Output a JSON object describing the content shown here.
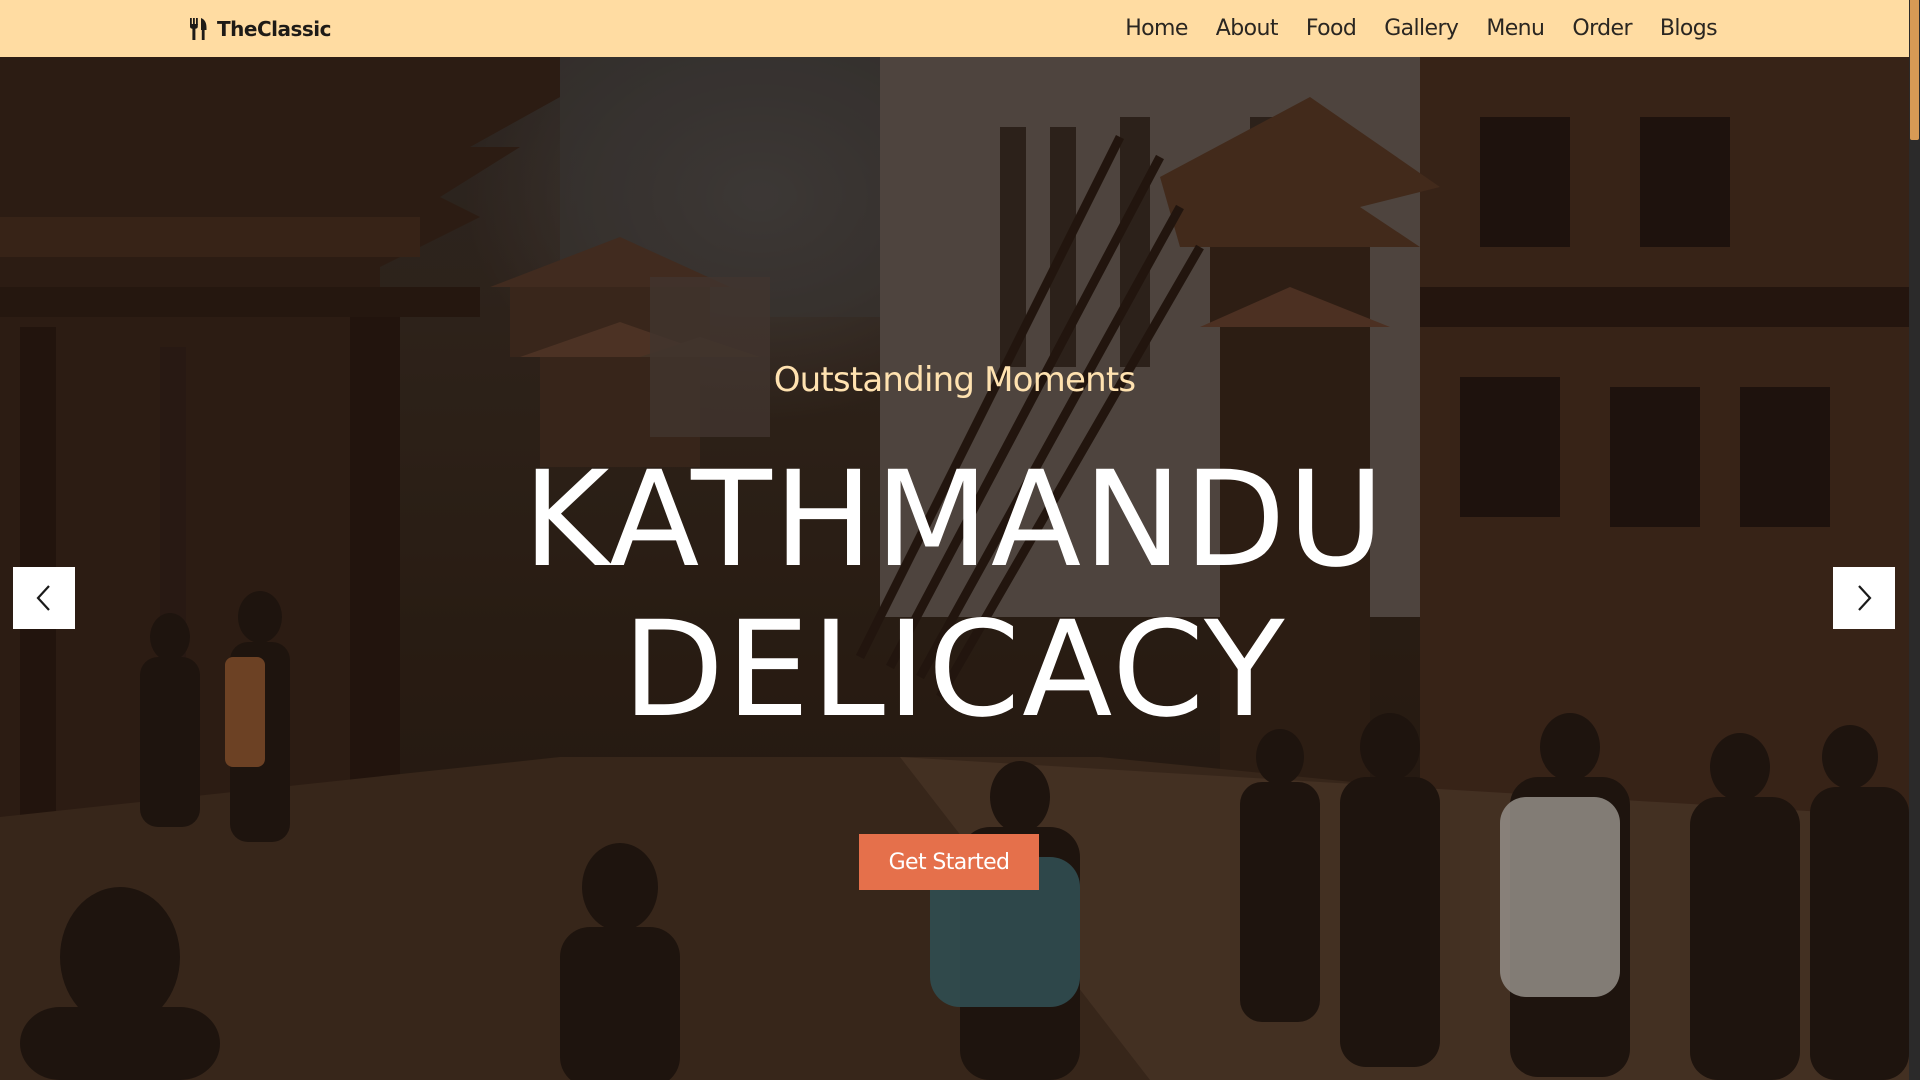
{
  "navbar": {
    "brand": {
      "icon": "fork-knife-icon",
      "name": "TheClassic"
    },
    "links": [
      {
        "label": "Home"
      },
      {
        "label": "About"
      },
      {
        "label": "Food"
      },
      {
        "label": "Gallery"
      },
      {
        "label": "Menu"
      },
      {
        "label": "Order"
      },
      {
        "label": "Blogs"
      }
    ]
  },
  "hero": {
    "subtitle": "Outstanding Moments",
    "title_line1": "KATHMANDU",
    "title_line2": "DELICACY",
    "cta_label": "Get Started",
    "prev_icon": "chevron-left-icon",
    "next_icon": "chevron-right-icon"
  },
  "colors": {
    "navbar_bg": "#ffdca2",
    "subtitle": "#ffe2b0",
    "cta_bg": "#e5704b",
    "title": "#ffffff",
    "scroll_thumb": "#d79a55"
  }
}
